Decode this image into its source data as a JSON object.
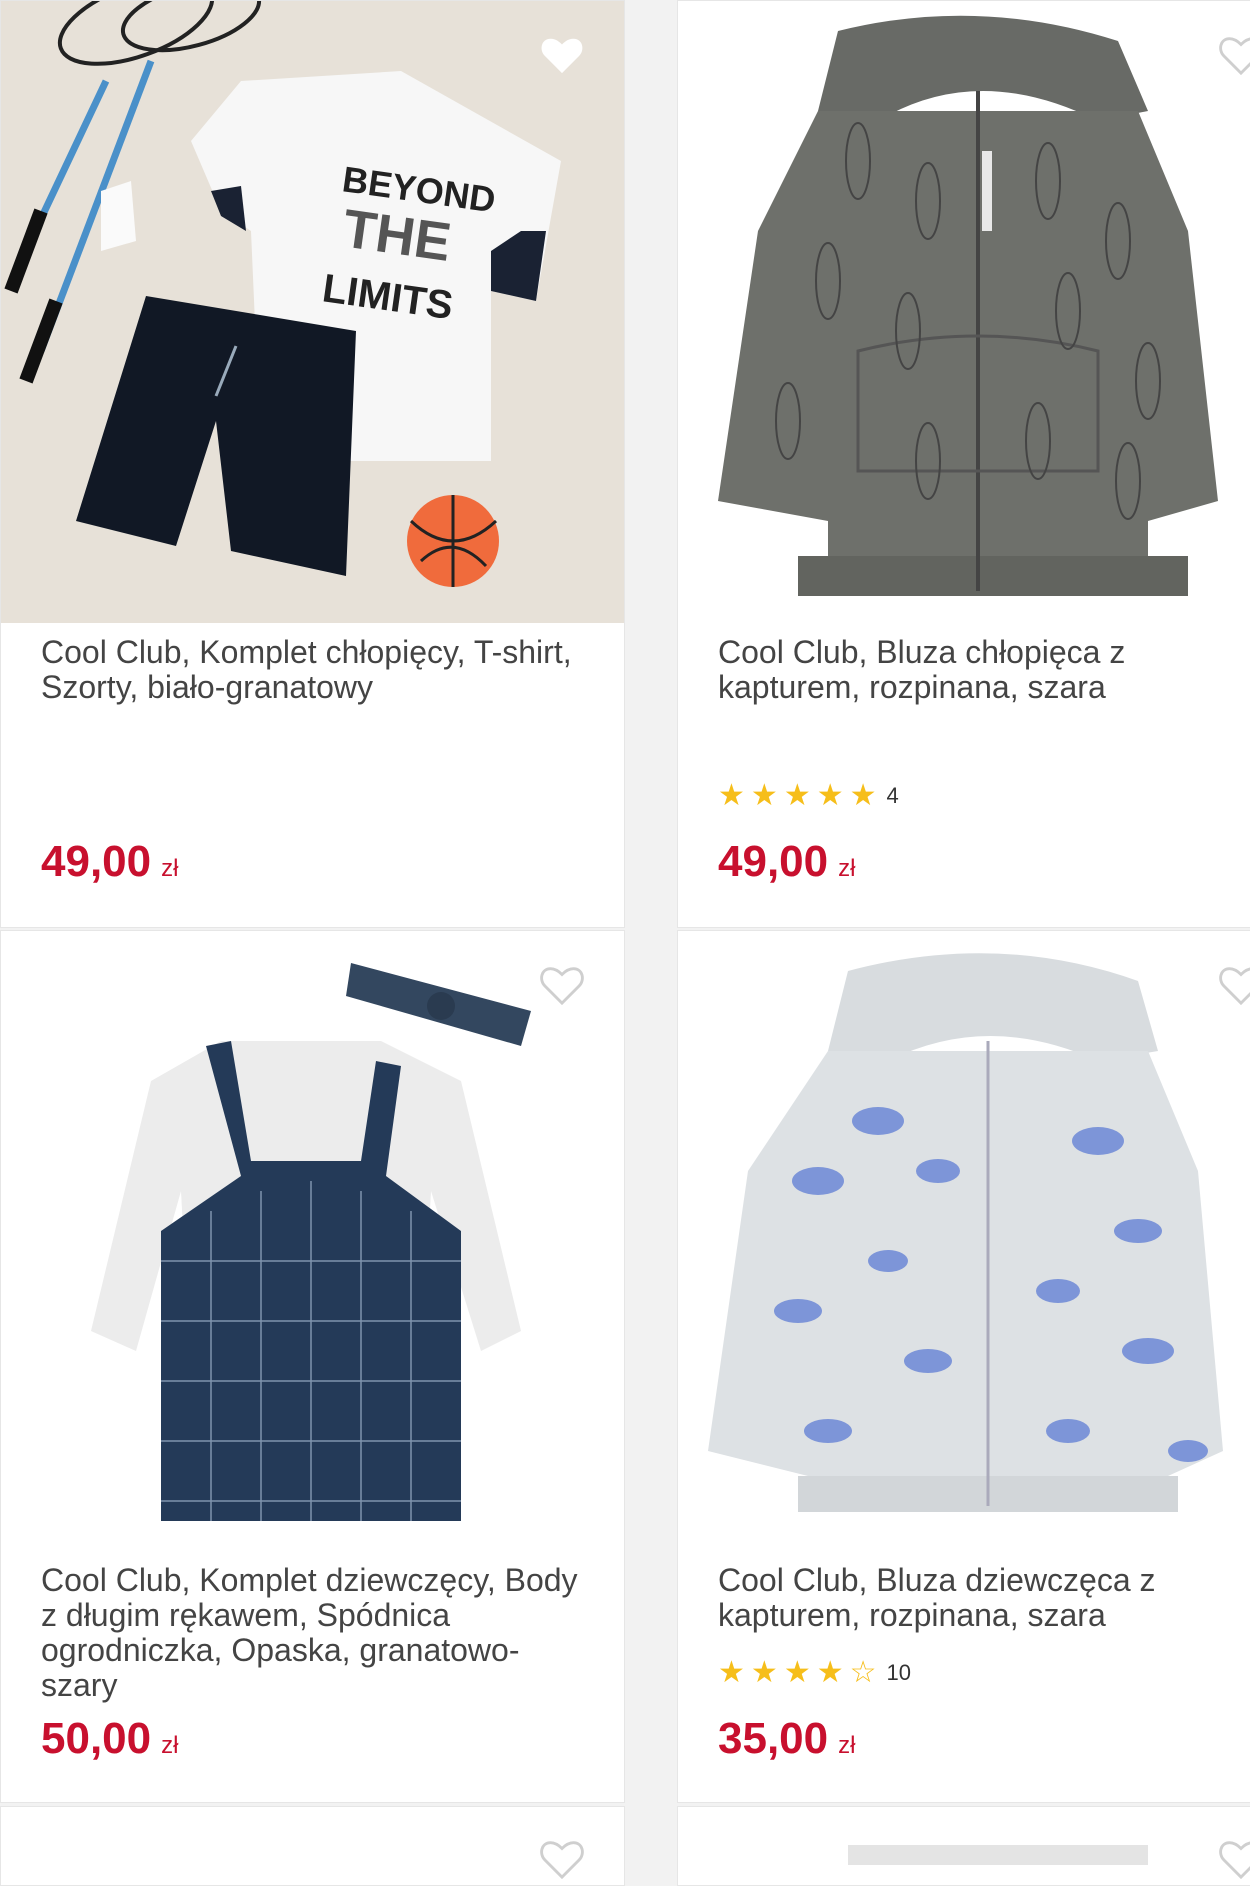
{
  "products": [
    {
      "title": "Cool Club, Komplet chłopięcy, T-shirt, Szorty, biało-granatowy",
      "price": "49,00",
      "currency": "zł",
      "favorited": true
    },
    {
      "title": "Cool Club, Bluza chłopięca z kapturem, rozpinana, szara",
      "price": "49,00",
      "currency": "zł",
      "rating": 5,
      "review_count": "4",
      "favorited": false
    },
    {
      "title": "Cool Club, Komplet dziewczęcy, Body z długim rękawem, Spódnica ogrodniczka, Opaska, granatowo-szary",
      "price": "50,00",
      "currency": "zł",
      "favorited": false
    },
    {
      "title": "Cool Club, Bluza dziewczęca z kapturem, rozpinana, szara",
      "price": "35,00",
      "currency": "zł",
      "rating": 4.5,
      "review_count": "10",
      "favorited": false
    }
  ],
  "colors": {
    "price": "#c8102e",
    "star": "#f6be1a"
  },
  "icons": [
    "heart-icon",
    "star-icon"
  ]
}
